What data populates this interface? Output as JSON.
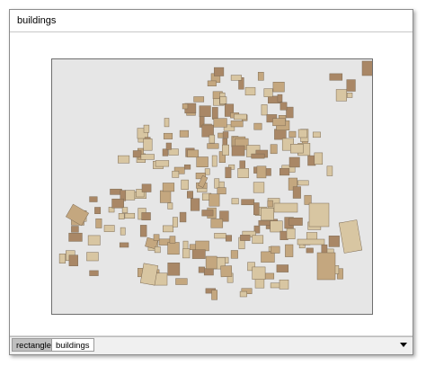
{
  "window": {
    "title": "buildings"
  },
  "tabs": [
    {
      "label": "rectangle",
      "active": true
    },
    {
      "label": "buildings",
      "active": false
    }
  ],
  "colors": {
    "map_background": "#e6e6e6",
    "building_light": "#d8c6a2",
    "building_medium": "#c4a77f",
    "building_dark": "#a98766",
    "building_stroke": "#7d6b55"
  },
  "icons": {
    "tab_dropdown": "chevron-down-icon"
  }
}
